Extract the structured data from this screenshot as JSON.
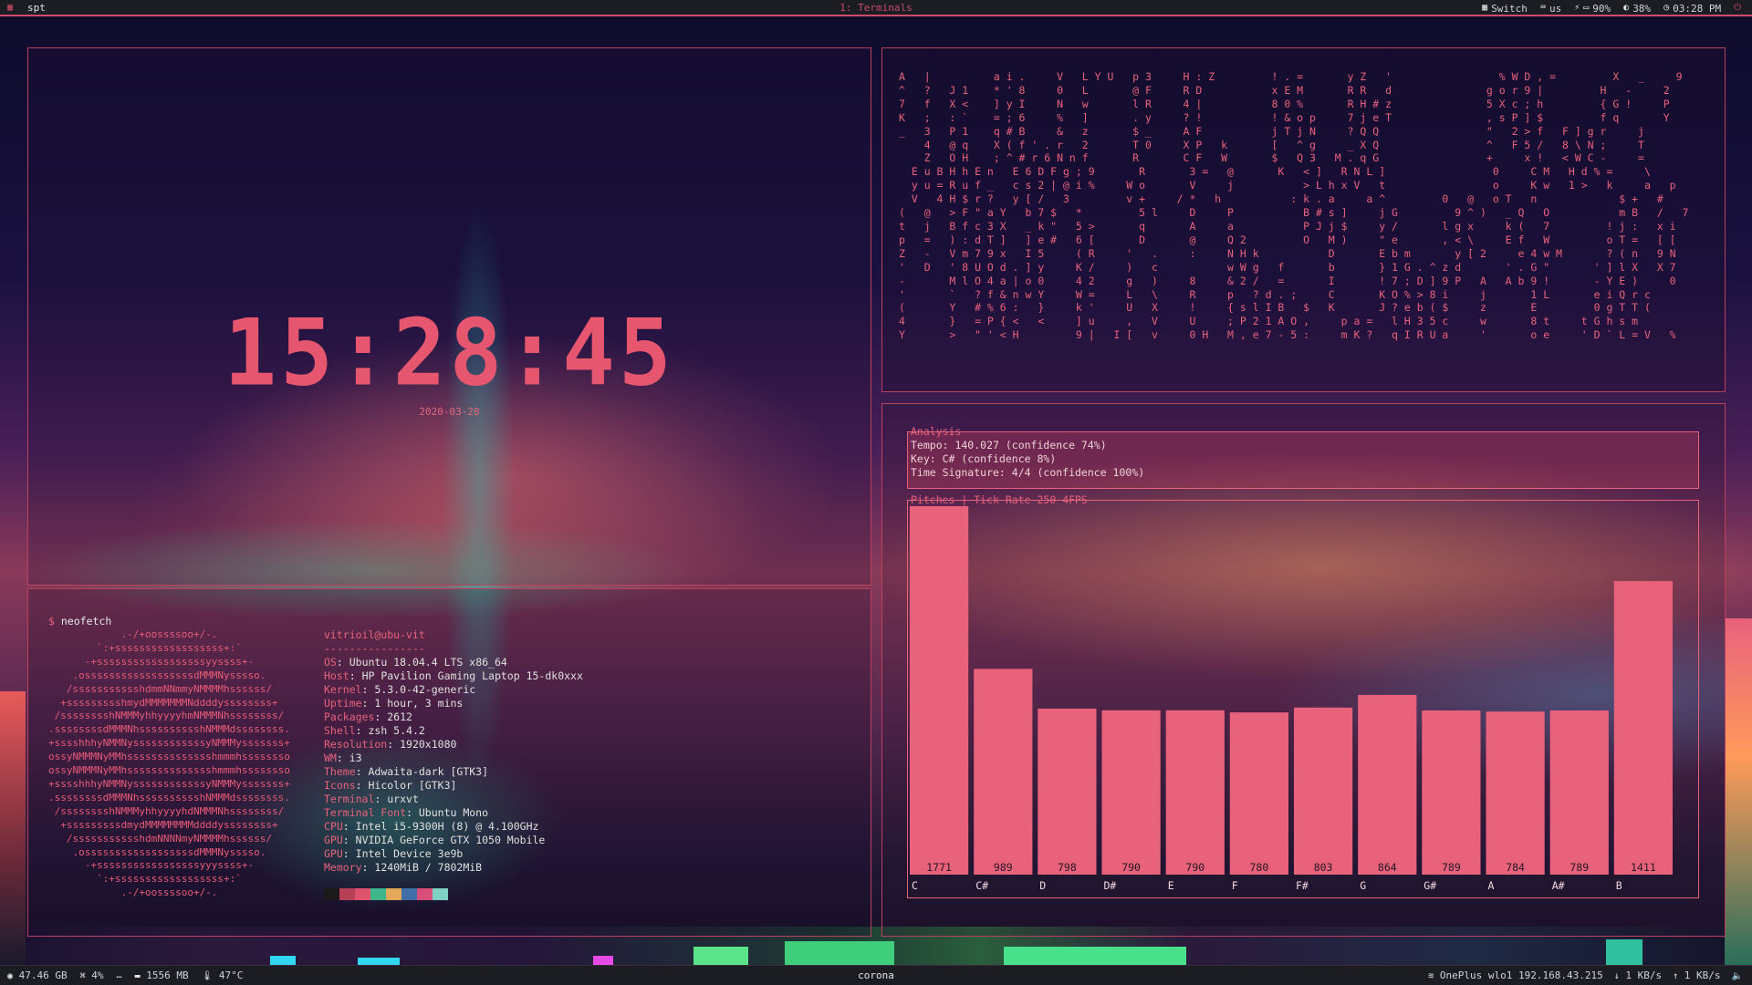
{
  "topbar": {
    "workspace_name": "spt",
    "window_title": "1: Terminals",
    "modules": {
      "switch_label": "Switch",
      "keyboard": "us",
      "battery": "90%",
      "brightness": "38%",
      "time": "03:28 PM"
    }
  },
  "clock": {
    "time": "15:28:45",
    "date": "2020-03-28"
  },
  "matrix": {
    "lines": [
      "A   |          a i .     V   L Y U   p 3     H : Z         ! . =       y Z   '                 % W D , =         X   _     9",
      "^   ?   J 1    * ' 8     0   L       @ F     R D           x E M       R R   d               g o r 9 |         H   -     2",
      "7   f   X <    ] y I     N   w       l R     4 |           8 0 %       R H # z               5 X c ; h         { G !     P",
      "K   ;   : `    = ; 6     %   ]       . y     ? !           ! & o p     7 j e T               , s P ] $         f q       Y",
      "_   3   P 1    q # B     &   z       $ _     A F           j T j N     ? Q Q                 \"   2 > f   F ] g r     j",
      "    4   @ q    X ( f ' . r   2       T 0     X P   k       [   ^ g     _ X Q                 ^   F 5 /   8 \\ N ;     T",
      "    Z   O H    ; ^ # r 6 N n f       R       C F   W       $   Q 3   M . q G                 +     x !   < W C -     =",
      "  E u B H h E n   E 6 D F g ; 9       R       3 =   @       K   < ]   R N L ]                 0     C M   H d % =     \\",
      "  y u = R u f _   c s 2 | @ i %     W o       V     j           > L h x V   t                 o     K w   1 >   k     a   p",
      "  V   4 H $ r ?   y [ /   3         v +     / *   h           : k . a     a ^         0   @   o T   n             $ +   #",
      "(   @   > F \" a Y   b 7 $   *         5 l     D     P           B # s ]     j G         9 ^ )   _ Q   O           m B   /   7",
      "t   j   B f c 3 X   _ k \"   5 >       q       A     a           P J j $     y /       l g x     k (   7         ! j :   x i",
      "p   =   ) : d T ]   ] e #   6 [       D       @     Q 2         O   M )     \" e       , < \\     E f   W         o T =   [ [",
      "Z   -   V m 7 9 x   I 5     ( R     '   .     :     N H k           D       E b m       y [ 2     e 4 w M       ? ( n   9 N",
      "'   D   ' 8 U O d . ] y     K /     )   c           w W g   f       b       } 1 G . ^ z d       ' . G \"       ' ] l X   X 7",
      "-       M l O 4 a | o 0     4 2     g   )     8     & 2 /   =       I       ! 7 ; D ] 9 P   A   A b 9 !       - Y E )     0",
      "'       `   ? f & n w Y     W =     L   \\     R     p   ? d . ;     C       K O % > 8 i     j       1 L       e i Q r c",
      "(       Y   # % 6 :   }     k '     U   X     !     { s l I B   $   K       J ? e b ( $     z       E         0 g T T (",
      "4       }   = P { <   <     ] u     ,   V     U     ; P 2 1 A O ,     p a =   l H 3 5 c     w       8 t     t G h s m",
      "Y       >   \" ' < H         9 |   I [   v     0 H   M , e 7 - 5 :     m K ?   q I R U a     '       o e     ' D ` L = V   %"
    ]
  },
  "neofetch": {
    "command": "neofetch",
    "user_host": "vitrioil@ubu-vit",
    "separator": "----------------",
    "info": [
      {
        "key": "OS",
        "value": "Ubuntu 18.04.4 LTS x86_64"
      },
      {
        "key": "Host",
        "value": "HP Pavilion Gaming Laptop 15-dk0xxx"
      },
      {
        "key": "Kernel",
        "value": "5.3.0-42-generic"
      },
      {
        "key": "Uptime",
        "value": "1 hour, 3 mins"
      },
      {
        "key": "Packages",
        "value": "2612"
      },
      {
        "key": "Shell",
        "value": "zsh 5.4.2"
      },
      {
        "key": "Resolution",
        "value": "1920x1080"
      },
      {
        "key": "WM",
        "value": "i3"
      },
      {
        "key": "Theme",
        "value": "Adwaita-dark [GTK3]"
      },
      {
        "key": "Icons",
        "value": "Hicolor [GTK3]"
      },
      {
        "key": "Terminal",
        "value": "urxvt"
      },
      {
        "key": "Terminal Font",
        "value": "Ubuntu Mono"
      },
      {
        "key": "CPU",
        "value": "Intel i5-9300H (8) @ 4.100GHz"
      },
      {
        "key": "GPU",
        "value": "NVIDIA GeForce GTX 1050 Mobile"
      },
      {
        "key": "GPU",
        "value": "Intel Device 3e9b"
      },
      {
        "key": "Memory",
        "value": "1240MiB / 7802MiB"
      }
    ],
    "palette": [
      "#1a1a1a",
      "#b8415a",
      "#e0536c",
      "#3fb68a",
      "#e3a958",
      "#3f6fa8",
      "#d8507a",
      "#7ed0c2"
    ],
    "art": [
      "            .-/+oossssoo+/-.",
      "        `:+ssssssssssssssssss+:`",
      "      -+ssssssssssssssssssyyssss+-",
      "    .ossssssssssssssssssdMMMNysssso.",
      "   /ssssssssssshdmmNNmmyNMMMMhssssss/",
      "  +ssssssssshmydMMMMMMMNddddyssssssss+",
      " /sssssssshNMMMyhhyyyyhmNMMMNhssssssss/",
      ".ssssssssdMMMNhsssssssssshNMMMdssssssss.",
      "+sssshhhyNMMNyssssssssssssyNMMMysssssss+",
      "ossyNMMMNyMMhsssssssssssssshmmmhssssssso",
      "ossyNMMMNyMMhsssssssssssssshmmmhssssssso",
      "+sssshhhyNMMNyssssssssssssyNMMMysssssss+",
      ".ssssssssdMMMNhsssssssssshNMMMdssssssss.",
      " /sssssssshNMMMyhhyyyyhdNMMMNhssssssss/",
      "  +sssssssssdmydMMMMMMMMddddyssssssss+",
      "   /ssssssssssshdmNNNNmyNMMMMhssssss/",
      "    .ossssssssssssssssssdMMMNysssso.",
      "      -+sssssssssssssssssyyyssss+-",
      "        `:+ssssssssssssssssss+:`",
      "            .-/+oossssoo+/-."
    ]
  },
  "spt": {
    "analysis_title": "Analysis",
    "tempo": "Tempo: 140.027 (confidence 74%)",
    "key": "Key: C# (confidence 8%)",
    "time_signature": "Time Signature: 4/4 (confidence 100%)",
    "pitches_title": "Pitches | Tick Rate 250 4FPS"
  },
  "chart_data": {
    "type": "bar",
    "title": "Pitches | Tick Rate 250 4FPS",
    "categories": [
      "C",
      "C#",
      "D",
      "D#",
      "E",
      "F",
      "F#",
      "G",
      "G#",
      "A",
      "A#",
      "B"
    ],
    "values": [
      1771,
      989,
      798,
      790,
      790,
      780,
      803,
      864,
      789,
      784,
      789,
      1411
    ],
    "ylim": [
      0,
      1771
    ],
    "bar_color": "#e8627c",
    "label_color": "#241622",
    "axis_label_color": "#f1d6dc",
    "grid": false
  },
  "bottombar": {
    "disk": "47.46 GB",
    "cpu": "4%",
    "memory": "1556 MB",
    "temperature": "47°C",
    "center_title": "corona",
    "network": "OnePlus wlo1 192.168.43.215",
    "download": "1 KB/s",
    "upload": "1 KB/s",
    "volume_level": 0.62,
    "colors": {
      "volume": "#6cc36c",
      "accent": "#d04a6c"
    }
  }
}
